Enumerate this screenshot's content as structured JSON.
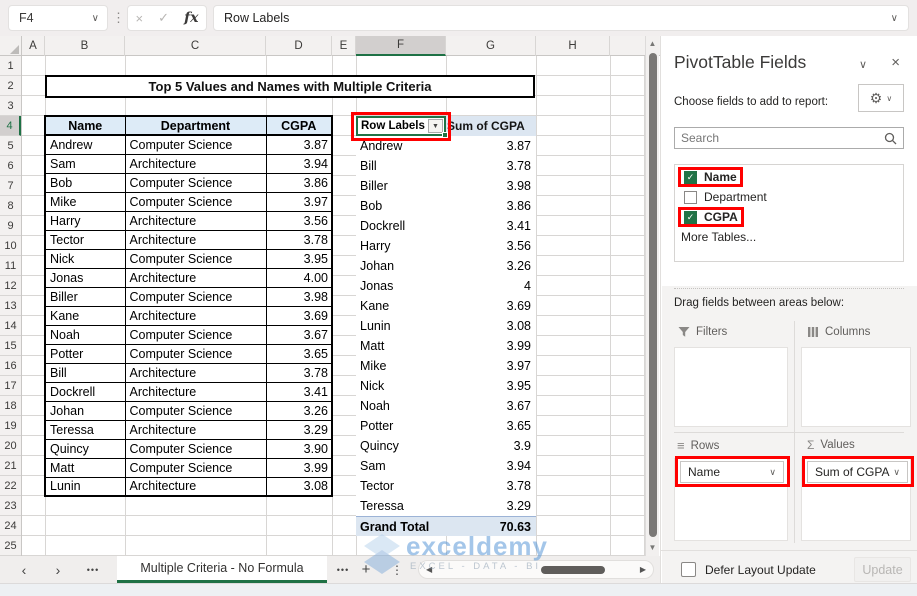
{
  "formula_bar": {
    "cell_reference": "F4",
    "formula_text": "Row Labels",
    "fx_label": "fx"
  },
  "icons": {
    "chevron_down": "∨",
    "dropdown_arrow": "▼",
    "cancel": "×",
    "enter": "✓",
    "close": "×",
    "vertical_dots": "⋮",
    "nav_left": "‹",
    "nav_right": "›",
    "ellipsis": "•••",
    "plus": "+",
    "scroll_up": "▲",
    "scroll_down": "▼",
    "scroll_left": "◀",
    "scroll_right": "▶",
    "gear": "⚙",
    "sigma": "Σ",
    "rows_lines": "≡",
    "check": "✓"
  },
  "grid": {
    "column_headers": [
      "A",
      "B",
      "C",
      "D",
      "E",
      "F",
      "G",
      "H"
    ],
    "selected_column": "F",
    "selected_row": 4,
    "row_count": 25,
    "title": "Top 5 Values and Names with Multiple Criteria",
    "data_table": {
      "headers": [
        "Name",
        "Department",
        "CGPA"
      ],
      "rows": [
        [
          "Andrew",
          "Computer Science",
          "3.87"
        ],
        [
          "Sam",
          "Architecture",
          "3.94"
        ],
        [
          "Bob",
          "Computer Science",
          "3.86"
        ],
        [
          "Mike",
          "Computer Science",
          "3.97"
        ],
        [
          "Harry",
          "Architecture",
          "3.56"
        ],
        [
          "Tector",
          "Architecture",
          "3.78"
        ],
        [
          "Nick",
          "Computer Science",
          "3.95"
        ],
        [
          "Jonas",
          "Architecture",
          "4.00"
        ],
        [
          "Biller",
          "Computer Science",
          "3.98"
        ],
        [
          "Kane",
          "Architecture",
          "3.69"
        ],
        [
          "Noah",
          "Computer Science",
          "3.67"
        ],
        [
          "Potter",
          "Computer Science",
          "3.65"
        ],
        [
          "Bill",
          "Architecture",
          "3.78"
        ],
        [
          "Dockrell",
          "Architecture",
          "3.41"
        ],
        [
          "Johan",
          "Computer Science",
          "3.26"
        ],
        [
          "Teressa",
          "Architecture",
          "3.29"
        ],
        [
          "Quincy",
          "Computer Science",
          "3.90"
        ],
        [
          "Matt",
          "Computer Science",
          "3.99"
        ],
        [
          "Lunin",
          "Architecture",
          "3.08"
        ]
      ]
    },
    "pivot_table": {
      "row_labels_header": "Row Labels",
      "values_header": "Sum of CGPA",
      "rows": [
        [
          "Andrew",
          "3.87"
        ],
        [
          "Bill",
          "3.78"
        ],
        [
          "Biller",
          "3.98"
        ],
        [
          "Bob",
          "3.86"
        ],
        [
          "Dockrell",
          "3.41"
        ],
        [
          "Harry",
          "3.56"
        ],
        [
          "Johan",
          "3.26"
        ],
        [
          "Jonas",
          "4"
        ],
        [
          "Kane",
          "3.69"
        ],
        [
          "Lunin",
          "3.08"
        ],
        [
          "Matt",
          "3.99"
        ],
        [
          "Mike",
          "3.97"
        ],
        [
          "Nick",
          "3.95"
        ],
        [
          "Noah",
          "3.67"
        ],
        [
          "Potter",
          "3.65"
        ],
        [
          "Quincy",
          "3.9"
        ],
        [
          "Sam",
          "3.94"
        ],
        [
          "Tector",
          "3.78"
        ],
        [
          "Teressa",
          "3.29"
        ]
      ],
      "grand_total_label": "Grand Total",
      "grand_total_value": "70.63"
    }
  },
  "sheet_tabs": {
    "active_tab": "Multiple Criteria - No Formula"
  },
  "panel": {
    "title": "PivotTable Fields",
    "subtitle": "Choose fields to add to report:",
    "search_placeholder": "Search",
    "fields": [
      {
        "label": "Name",
        "checked": true,
        "highlighted": true
      },
      {
        "label": "Department",
        "checked": false,
        "highlighted": false
      },
      {
        "label": "CGPA",
        "checked": true,
        "highlighted": true
      }
    ],
    "more_tables_label": "More Tables...",
    "drag_label": "Drag fields between areas below:",
    "areas": {
      "filters": "Filters",
      "columns": "Columns",
      "rows": "Rows",
      "values": "Values"
    },
    "rows_field": "Name",
    "values_field": "Sum of CGPA",
    "defer_label": "Defer Layout Update",
    "update_label": "Update"
  },
  "watermark": {
    "brand": "exceldemy",
    "tagline": "EXCEL - DATA - BI"
  },
  "colors": {
    "excel_green": "#217346",
    "annotation_red": "#FF0000",
    "table_header_blue": "#DDEBF7",
    "pivot_blue": "#DCE6F1",
    "watermark_blue": "#4B8FD4"
  }
}
